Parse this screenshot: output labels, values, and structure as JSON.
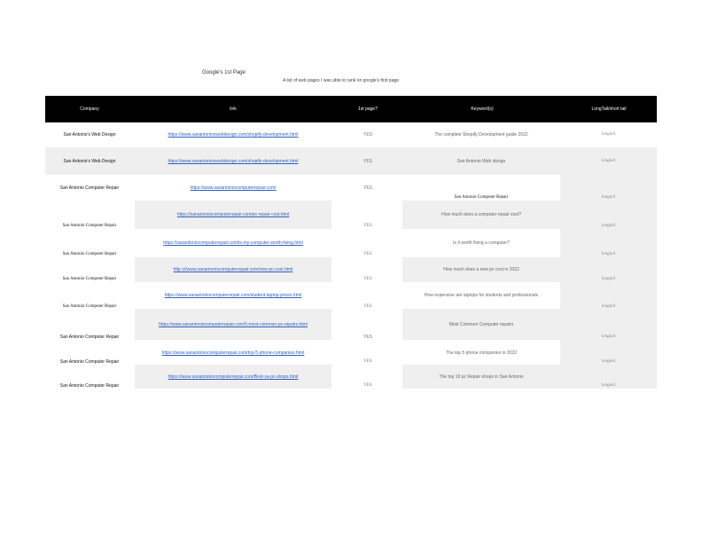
{
  "page": {
    "title": "Google's 1st Page",
    "subtitle": "A list of web pages I was able to rank on google's first page"
  },
  "table": {
    "headers": [
      "Company",
      "link",
      "1st page?",
      "Keyword(s)",
      "LongTail/short tail"
    ],
    "rows": [
      {
        "company": "San Antonio's Web Design",
        "link": "https://www.sanantonioswebdesign.com/shopify-development.html",
        "first_page": "YES",
        "keyword": "The complete Shopify Development guide 2022",
        "tail": "longtail"
      },
      {
        "company": "San Antonio's Web Design",
        "link": "https://www.sanantonioswebdesign.com/shopify-development.html",
        "first_page": "YES",
        "keyword": "San Antonio Web design",
        "tail": "longtail"
      },
      {
        "company": "San Antonio Computer Repair",
        "link": "https://www.sanantoniocomputerrepair.com/",
        "first_page": "YES",
        "keyword": "San Antonio Computer Repair",
        "tail": "longtail"
      },
      {
        "company": "San Antonio Computer Repair",
        "link": "https://sanantoniocomputerrepair.com/pc-repair-cost.html",
        "first_page": "YES",
        "keyword": "How much does a computer repair cost?",
        "tail": "longtail"
      },
      {
        "company": "San Antonio Computer Repair",
        "link": "https://sanantoniocomputerrepair.com/is-my-computer-worth-fixing.html",
        "first_page": "YES",
        "keyword": "Is it worth fixing a computer?",
        "tail": "longtail"
      },
      {
        "company": "San Antonio Computer Repair",
        "link": "http s//www.sanantoniocomputerrepair.com/new-pc-cost.html",
        "first_page": "YES",
        "keyword": "How much does a new pc cost in 2022",
        "tail": "longtail"
      },
      {
        "company": "San Antonio Computer Repair",
        "link": "https://www.sanantoniocomputerrepair.com/student-laptop-prices.html",
        "first_page": "YES",
        "keyword": "How expensive are laptops for students and professionals",
        "tail": "longtail"
      },
      {
        "company": "San Antonio Computer Repair",
        "link": "https://www.sanantoniocomputerrepair.com/5-most-common-pc-repairs.html",
        "first_page": "YES",
        "keyword": "Most Common Computer repairs",
        "tail": "longtail"
      },
      {
        "company": "San Antonio Computer Repair",
        "link": "https://www.sanantoniocomputerrepair.com/top-5-phone-companies.html",
        "first_page": "YES",
        "keyword": "The top 5 phone companies in 2022",
        "tail": "longtail"
      },
      {
        "company": "San Antonio Computer Repair",
        "link": "https://www.sanantoniocomputerrepair.com/Best-sa-pc-shops.html",
        "first_page": "YES",
        "keyword": "The top 10 pc Repair shops in San Antonio",
        "tail": "longtail"
      }
    ]
  }
}
